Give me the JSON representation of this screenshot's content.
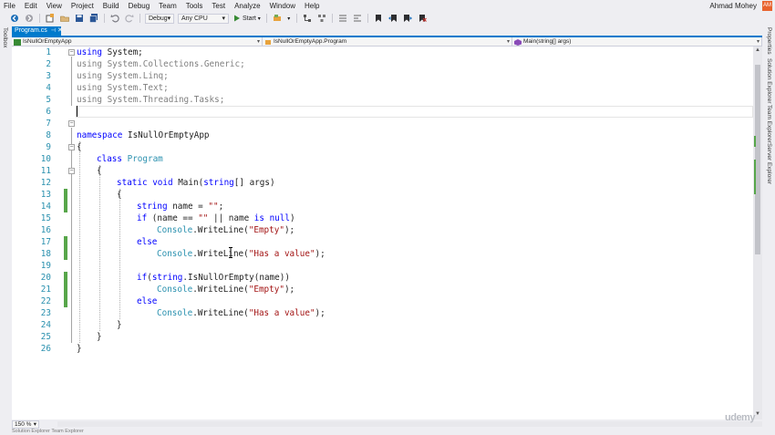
{
  "menu": {
    "items": [
      "File",
      "Edit",
      "View",
      "Project",
      "Build",
      "Debug",
      "Team",
      "Tools",
      "Test",
      "Analyze",
      "Window",
      "Help"
    ],
    "user": "Ahmad Mohey",
    "avatar_initials": "AM"
  },
  "toolbar": {
    "config": "Debug",
    "platform": "Any CPU",
    "start_label": "Start"
  },
  "left_panel": {
    "toolbox_label": "Toolbox"
  },
  "right_panel": {
    "labels": [
      "Properties",
      "Solution Explorer",
      "Team Explorer",
      "Server Explorer"
    ]
  },
  "tab": {
    "label": "Program.cs"
  },
  "navbar": {
    "project": "IsNullOrEmptyApp",
    "type": "IsNullOrEmptyApp.Program",
    "member": "Main(string[] args)"
  },
  "editor": {
    "lines": [
      {
        "n": "1"
      },
      {
        "n": "2"
      },
      {
        "n": "3"
      },
      {
        "n": "4"
      },
      {
        "n": "5"
      },
      {
        "n": "6"
      },
      {
        "n": "7"
      },
      {
        "n": "8"
      },
      {
        "n": "9"
      },
      {
        "n": "10"
      },
      {
        "n": "11"
      },
      {
        "n": "12"
      },
      {
        "n": "13"
      },
      {
        "n": "14"
      },
      {
        "n": "15"
      },
      {
        "n": "16"
      },
      {
        "n": "17"
      },
      {
        "n": "18"
      },
      {
        "n": "19"
      },
      {
        "n": "20"
      },
      {
        "n": "21"
      },
      {
        "n": "22"
      },
      {
        "n": "23"
      },
      {
        "n": "24"
      },
      {
        "n": "25"
      },
      {
        "n": "26"
      }
    ],
    "code": {
      "l1_kw": "using",
      "l1_rest": " System;",
      "l2": "using System.Collections.Generic;",
      "l3": "using System.Linq;",
      "l4": "using System.Text;",
      "l5": "using System.Threading.Tasks;",
      "l8_kw": "namespace",
      "l8_rest": " IsNullOrEmptyApp",
      "l9": "{",
      "l10_kw": "class",
      "l10_ty": " Program",
      "l11": "{",
      "l12_kw1": "static",
      "l12_kw2": " void",
      "l12_a": " Main(",
      "l12_kw3": "string",
      "l12_b": "[] args)",
      "l13": "{",
      "l14_kw": "string",
      "l14_a": " name = ",
      "l14_st": "\"\"",
      "l14_b": ";",
      "l15_kw": "if",
      "l15_a": " (name == ",
      "l15_st": "\"\"",
      "l15_b": " || name ",
      "l15_kw2": "is",
      "l15_kw3": " null",
      "l15_c": ")",
      "l16_ty": "Console",
      "l16_a": ".WriteLine(",
      "l16_st": "\"Empty\"",
      "l16_b": ");",
      "l17_kw": "else",
      "l18_ty": "Console",
      "l18_a": ".WriteLine(",
      "l18_st": "\"Has a value\"",
      "l18_b": ");",
      "l20_kw": "if",
      "l20_a": "(",
      "l20_kw2": "string",
      "l20_b": ".IsNullOrEmpty(name))",
      "l21_ty": "Console",
      "l21_a": ".WriteLine(",
      "l21_st": "\"Empty\"",
      "l21_b": ");",
      "l22_kw": "else",
      "l23_ty": "Console",
      "l23_a": ".WriteLine(",
      "l23_st": "\"Has a value\"",
      "l23_b": ");",
      "l24": "}",
      "l25": "}",
      "l26": "}"
    }
  },
  "status": {
    "zoom": "150 %"
  },
  "bottom_tabs": "Solution Explorer   Team Explorer",
  "watermark": "udemy",
  "colors": {
    "accent": "#007acc",
    "keyword": "#0000ff",
    "type": "#2b91af",
    "string": "#a31515",
    "change_marker": "#57a64a",
    "avatar": "#e8632e"
  }
}
